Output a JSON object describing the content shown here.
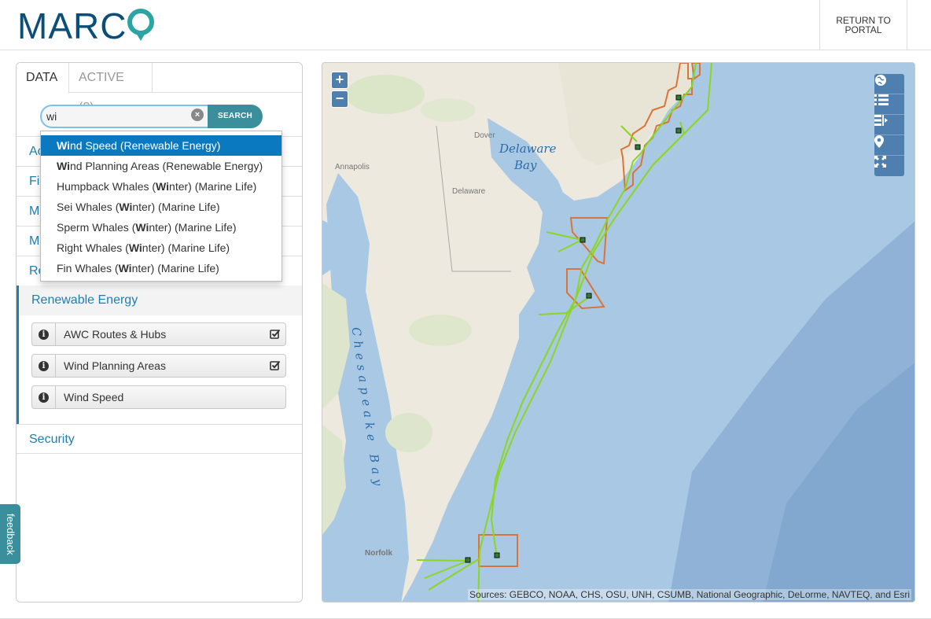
{
  "header": {
    "logo_text": "MARC",
    "logo_pin_letter": "O",
    "return_label": "RETURN TO\nPORTAL"
  },
  "tabs": [
    {
      "label": "DATA"
    },
    {
      "label": "ACTIVE (2)"
    }
  ],
  "search": {
    "value": "wi",
    "placeholder": "",
    "button_label": "SEARCH"
  },
  "dropdown": {
    "items": [
      {
        "match": "Wi",
        "before": "",
        "after": "nd Speed (Renewable Energy)"
      },
      {
        "match": "Wi",
        "before": "",
        "after": "nd Planning Areas (Renewable Energy)"
      },
      {
        "match": "Wi",
        "before": "Humpback Whales (",
        "after": "nter) (Marine Life)"
      },
      {
        "match": "Wi",
        "before": "Sei Whales (",
        "after": "nter) (Marine Life)"
      },
      {
        "match": "Wi",
        "before": "Sperm Whales (",
        "after": "nter) (Marine Life)"
      },
      {
        "match": "Wi",
        "before": "Right Whales (",
        "after": "nter) (Marine Life)"
      },
      {
        "match": "Wi",
        "before": "Fin Whales (",
        "after": "nter) (Marine Life)"
      }
    ]
  },
  "categories": {
    "hidden_rows": [
      "Ac",
      "Fi",
      "Ma",
      "Ma",
      "Re"
    ],
    "expanded_title": "Renewable Energy",
    "layers": [
      {
        "label": "AWC Routes & Hubs",
        "checked": true
      },
      {
        "label": "Wind Planning Areas",
        "checked": true
      },
      {
        "label": "Wind Speed",
        "checked": false
      }
    ],
    "security": "Security"
  },
  "map": {
    "zoom_in": "+",
    "zoom_out": "−",
    "labels": {
      "delaware_bay_1": "Delaware",
      "delaware_bay_2": "Bay",
      "chesapeake": "Chesapeake Bay",
      "dover": "Dover",
      "annapolis": "Annapolis",
      "delaware_state": "Delaware",
      "norfolk": "Norfolk"
    },
    "tools": [
      "globe-icon",
      "list-icon",
      "legend-icon",
      "marker-icon",
      "fullscreen-icon"
    ],
    "attribution": "Sources: GEBCO, NOAA, CHS, OSU, UNH, CSUMB, National Geographic, DeLorme, NAVTEQ, and Esri",
    "colors": {
      "water": "#a9c8e3",
      "deep_water": "#8fb2d6",
      "land": "#f1efe8",
      "route": "#8ad623",
      "wind_area": "#d9743a"
    }
  },
  "feedback_label": "feedback"
}
